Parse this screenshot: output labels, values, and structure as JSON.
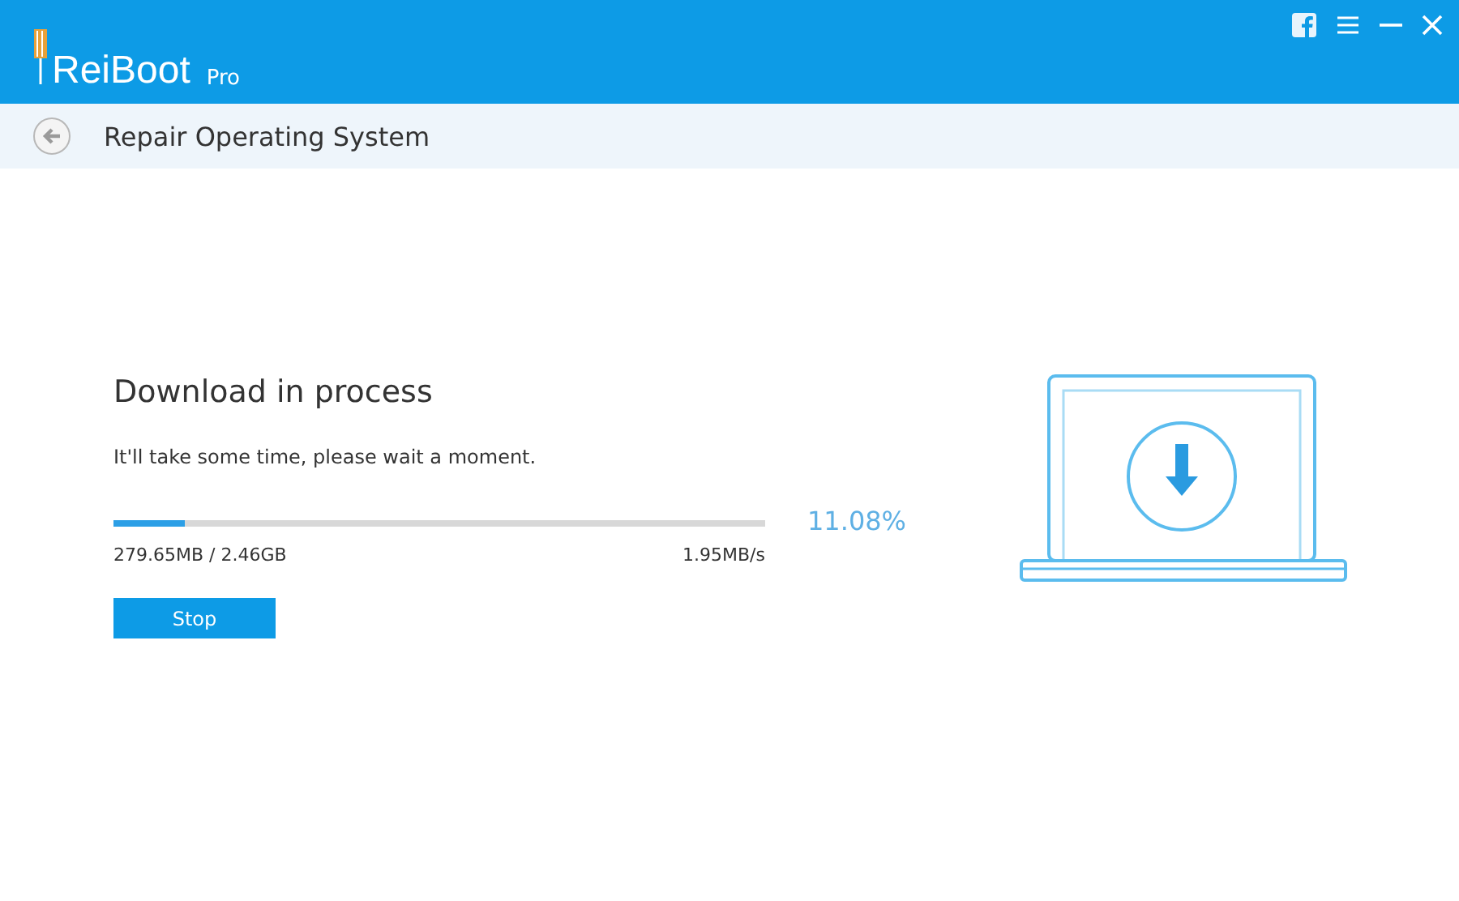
{
  "app": {
    "logo": "ReiBoot",
    "edition": "Pro"
  },
  "header": {
    "title": "Repair Operating System"
  },
  "download": {
    "heading": "Download in process",
    "note": "It'll take some time, please wait a moment.",
    "level": 0.11,
    "percent": "11.08%",
    "size": "279.65MB / 2.46GB",
    "speed": "1.95MB/s",
    "button": "Stop"
  }
}
